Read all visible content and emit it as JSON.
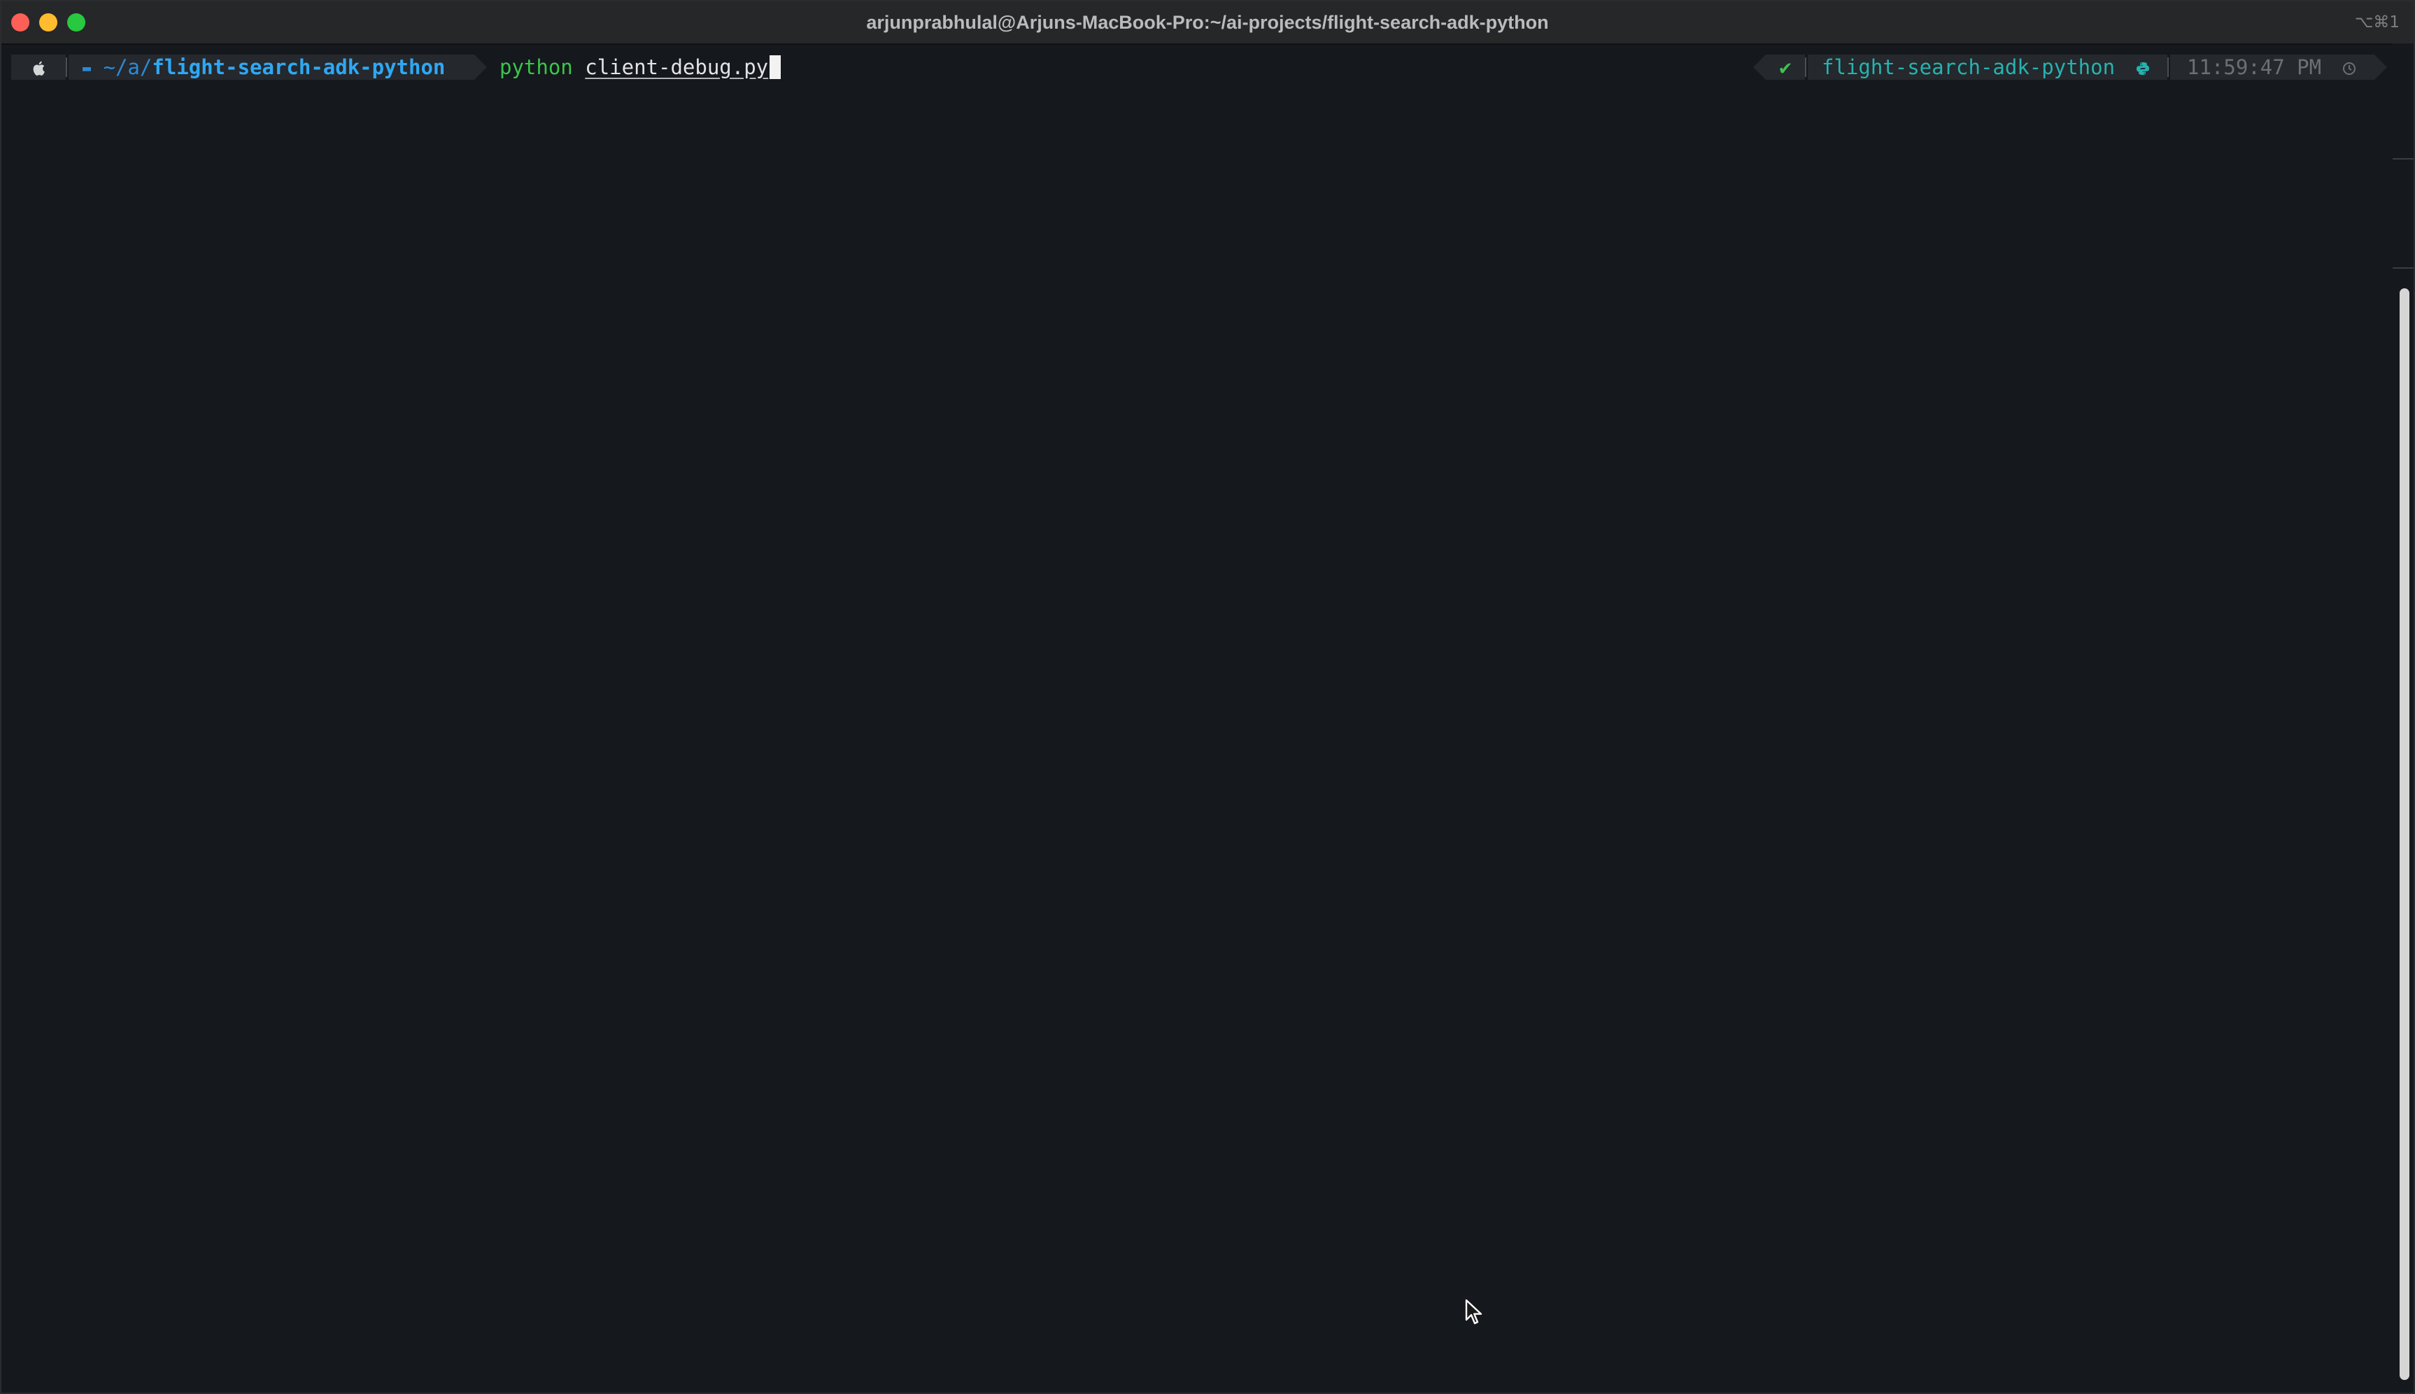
{
  "window": {
    "title": "arjunprabhulal@Arjuns-MacBook-Pro:~/ai-projects/flight-search-adk-python",
    "shortcut": "⌥⌘1"
  },
  "prompt": {
    "os_icon": "apple-icon",
    "dir_icon": "folder-icon",
    "dir_prefix": "~/a/",
    "dir_name": "flight-search-adk-python",
    "command": "python",
    "argument": "client-debug.py",
    "status_symbol": "✔",
    "env_name": "flight-search-adk-python",
    "env_icon": "python-icon",
    "time": "11:59:47 PM",
    "time_icon": "clock-icon"
  },
  "colors": {
    "background": "#15181c",
    "segment": "#25282c",
    "dir": "#2fa8f4",
    "command": "#39c64a",
    "env": "#25b3b0",
    "status_ok": "#3ec24f",
    "time": "#6b7075"
  }
}
